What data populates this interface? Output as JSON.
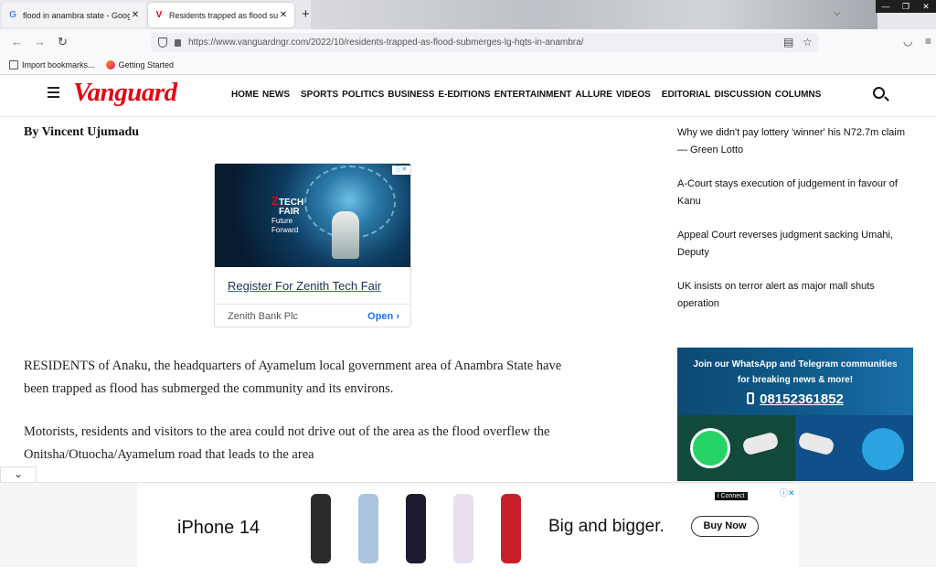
{
  "browser": {
    "tabs": [
      {
        "title": "flood in anambra state - Google",
        "favicon": "G",
        "active": false
      },
      {
        "title": "Residents trapped as flood subm",
        "favicon": "V",
        "active": true
      }
    ],
    "url": "https://www.vanguardngr.com/2022/10/residents-trapped-as-flood-submerges-lg-hqts-in-anambra/",
    "bookmarks": [
      {
        "label": "Import bookmarks..."
      },
      {
        "label": "Getting Started"
      }
    ]
  },
  "site": {
    "logo": "Vanguard",
    "nav": [
      "HOME",
      "NEWS",
      "SPORTS",
      "POLITICS",
      "BUSINESS",
      "E-EDITIONS",
      "ENTERTAINMENT",
      "ALLURE",
      "VIDEOS",
      "EDITORIAL",
      "DISCUSSION",
      "COLUMNS"
    ]
  },
  "article": {
    "byline": "By Vincent Ujumadu",
    "paragraphs": [
      "RESIDENTS of Anaku, the headquarters of Ayamelum local government area of Anambra State have been trapped as flood has submerged the community and its environs.",
      "Motorists, residents and visitors to the area could not drive out of the area as the flood overflew the Onitsha/Otuocha/Ayamelum road that leads to the area"
    ]
  },
  "ad": {
    "brand_line1": "TECH",
    "brand_line2": "FAIR",
    "tag_line1": "Future",
    "tag_line2": "Forward",
    "cta": "Register For Zenith Tech Fair",
    "sponsor": "Zenith Bank Plc",
    "open_label": "Open"
  },
  "sidebar": {
    "links": [
      "Why we didn't pay lottery 'winner' his N72.7m claim — Green Lotto",
      "A-Court stays execution of judgement in favour of Kanu",
      "Appeal Court reverses judgment sacking Umahi, Deputy",
      "UK insists on terror alert as major mall shuts operation"
    ],
    "promo": {
      "line1": "Join our WhatsApp and Telegram communities",
      "line2": "for breaking news & more!",
      "phone": "08152361852"
    }
  },
  "bottom_ad": {
    "product": "iPhone 14",
    "tagline": "Big and bigger.",
    "button": "Buy Now",
    "partner": "i Connect",
    "phone_colors": [
      "#2b2b2b",
      "#aac4e0",
      "#1f1a2e",
      "#e8dff0",
      "#c8202b"
    ]
  }
}
